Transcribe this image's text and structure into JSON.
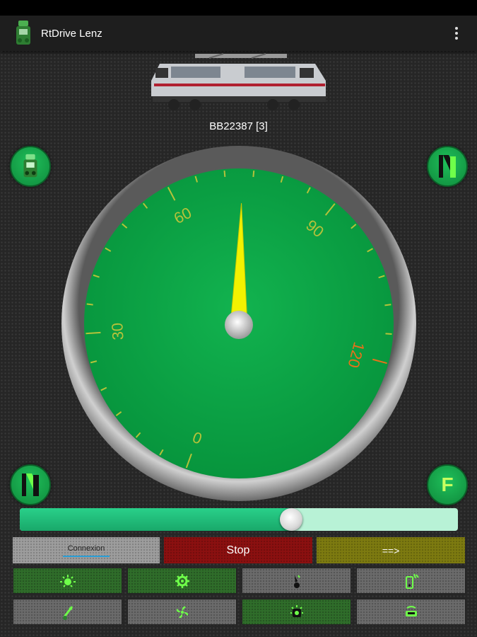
{
  "app": {
    "title": "RtDrive Lenz",
    "icon": "locomotive-icon",
    "menu_icon": "overflow-menu-icon"
  },
  "locomotive": {
    "name": "BB22387 [3]",
    "image": "electric-locomotive-image"
  },
  "side_buttons": {
    "top_left": "locomotive-icon",
    "top_right": "turnout-icon",
    "bottom_left": "turnout-icon",
    "bottom_right_label": "F"
  },
  "speedometer": {
    "tick_labels": [
      "0",
      "30",
      "60",
      "90",
      "120"
    ],
    "min": 0,
    "max": 120,
    "needle_value": 73,
    "colors": {
      "dial": "#0da84a",
      "label_normal": "#b5c23a",
      "label_max": "#e8701a",
      "needle": "#f2f200",
      "bezel": "#8c8c8c"
    }
  },
  "throttle": {
    "value_percent": 62,
    "fill_color": "#1fb879",
    "track_color": "#b8f2d6"
  },
  "controls": {
    "connect_label": "Connexion",
    "stop_label": "Stop",
    "direction_label": "==>"
  },
  "functions": [
    {
      "icon": "headlight-icon",
      "active": true
    },
    {
      "icon": "gear-icon",
      "active": true
    },
    {
      "icon": "horn-icon",
      "active": false
    },
    {
      "icon": "phone-sound-icon",
      "active": false
    },
    {
      "icon": "coupler-icon",
      "active": false
    },
    {
      "icon": "fan-icon",
      "active": false
    },
    {
      "icon": "cabin-light-icon",
      "active": true
    },
    {
      "icon": "shunting-icon",
      "active": false
    }
  ]
}
